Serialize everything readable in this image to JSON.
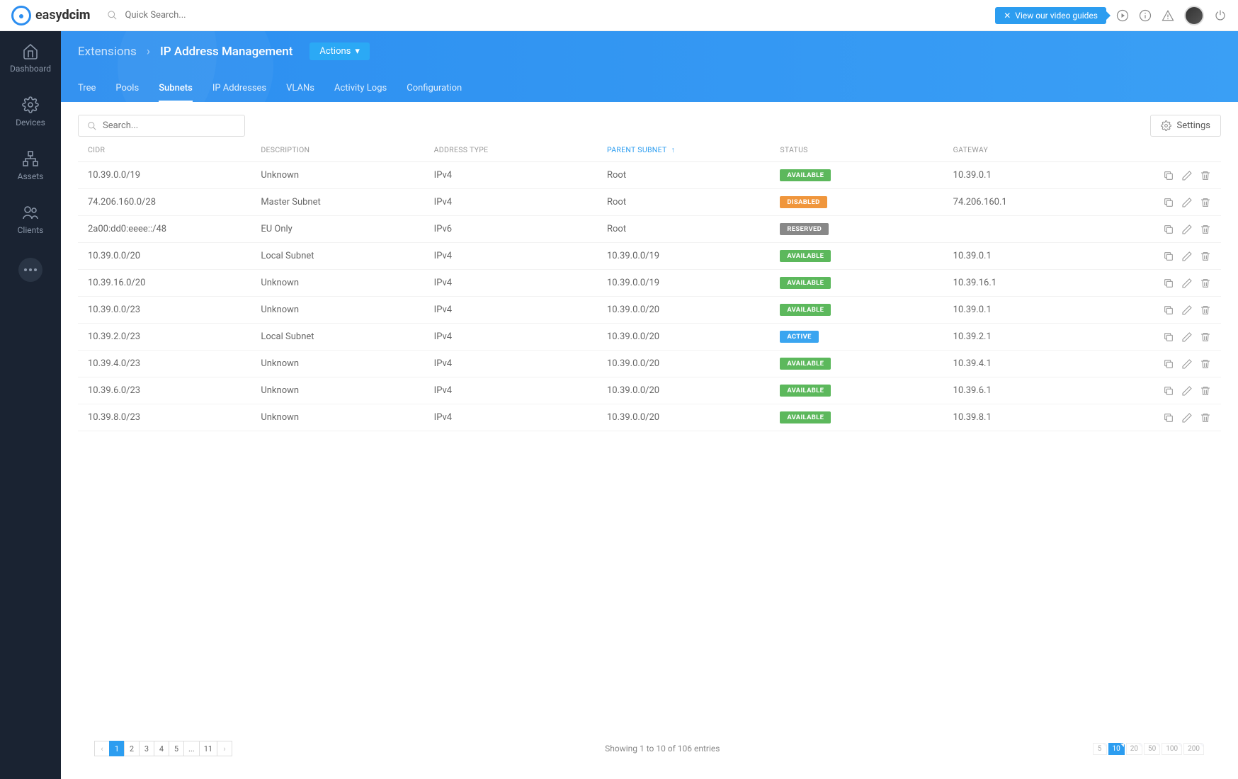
{
  "brand": {
    "name_a": "easy",
    "name_b": "dcim"
  },
  "topbar": {
    "search_placeholder": "Quick Search...",
    "video_guide": "View our video guides"
  },
  "sidebar": {
    "items": [
      {
        "label": "Dashboard"
      },
      {
        "label": "Devices"
      },
      {
        "label": "Assets"
      },
      {
        "label": "Clients"
      }
    ]
  },
  "breadcrumb": {
    "parent": "Extensions",
    "current": "IP Address Management",
    "actions": "Actions"
  },
  "tabs": [
    "Tree",
    "Pools",
    "Subnets",
    "IP Addresses",
    "VLANs",
    "Activity Logs",
    "Configuration"
  ],
  "active_tab": "Subnets",
  "toolbar": {
    "search_placeholder": "Search...",
    "settings": "Settings"
  },
  "columns": [
    "CIDR",
    "DESCRIPTION",
    "ADDRESS TYPE",
    "PARENT SUBNET",
    "STATUS",
    "GATEWAY"
  ],
  "sorted_col": "PARENT SUBNET",
  "rows": [
    {
      "cidr": "10.39.0.0/19",
      "desc": "Unknown",
      "type": "IPv4",
      "parent": "Root",
      "status": "AVAILABLE",
      "status_cls": "available",
      "gw": "10.39.0.1"
    },
    {
      "cidr": "74.206.160.0/28",
      "desc": "Master Subnet",
      "type": "IPv4",
      "parent": "Root",
      "status": "DISABLED",
      "status_cls": "disabled",
      "gw": "74.206.160.1"
    },
    {
      "cidr": "2a00:dd0:eeee::/48",
      "desc": "EU Only",
      "type": "IPv6",
      "parent": "Root",
      "status": "RESERVED",
      "status_cls": "reserved",
      "gw": ""
    },
    {
      "cidr": "10.39.0.0/20",
      "desc": "Local Subnet",
      "type": "IPv4",
      "parent": "10.39.0.0/19",
      "status": "AVAILABLE",
      "status_cls": "available",
      "gw": "10.39.0.1"
    },
    {
      "cidr": "10.39.16.0/20",
      "desc": "Unknown",
      "type": "IPv4",
      "parent": "10.39.0.0/19",
      "status": "AVAILABLE",
      "status_cls": "available",
      "gw": "10.39.16.1"
    },
    {
      "cidr": "10.39.0.0/23",
      "desc": "Unknown",
      "type": "IPv4",
      "parent": "10.39.0.0/20",
      "status": "AVAILABLE",
      "status_cls": "available",
      "gw": "10.39.0.1"
    },
    {
      "cidr": "10.39.2.0/23",
      "desc": "Local Subnet",
      "type": "IPv4",
      "parent": "10.39.0.0/20",
      "status": "ACTIVE",
      "status_cls": "active",
      "gw": "10.39.2.1"
    },
    {
      "cidr": "10.39.4.0/23",
      "desc": "Unknown",
      "type": "IPv4",
      "parent": "10.39.0.0/20",
      "status": "AVAILABLE",
      "status_cls": "available",
      "gw": "10.39.4.1"
    },
    {
      "cidr": "10.39.6.0/23",
      "desc": "Unknown",
      "type": "IPv4",
      "parent": "10.39.0.0/20",
      "status": "AVAILABLE",
      "status_cls": "available",
      "gw": "10.39.6.1"
    },
    {
      "cidr": "10.39.8.0/23",
      "desc": "Unknown",
      "type": "IPv4",
      "parent": "10.39.0.0/20",
      "status": "AVAILABLE",
      "status_cls": "available",
      "gw": "10.39.8.1"
    }
  ],
  "pagination": {
    "pages": [
      "1",
      "2",
      "3",
      "4",
      "5",
      "...",
      "11"
    ],
    "active": "1"
  },
  "entries_text": "Showing 1 to 10 of 106 entries",
  "page_sizes": [
    "5",
    "10",
    "20",
    "50",
    "100",
    "200"
  ],
  "page_size_active": "10"
}
